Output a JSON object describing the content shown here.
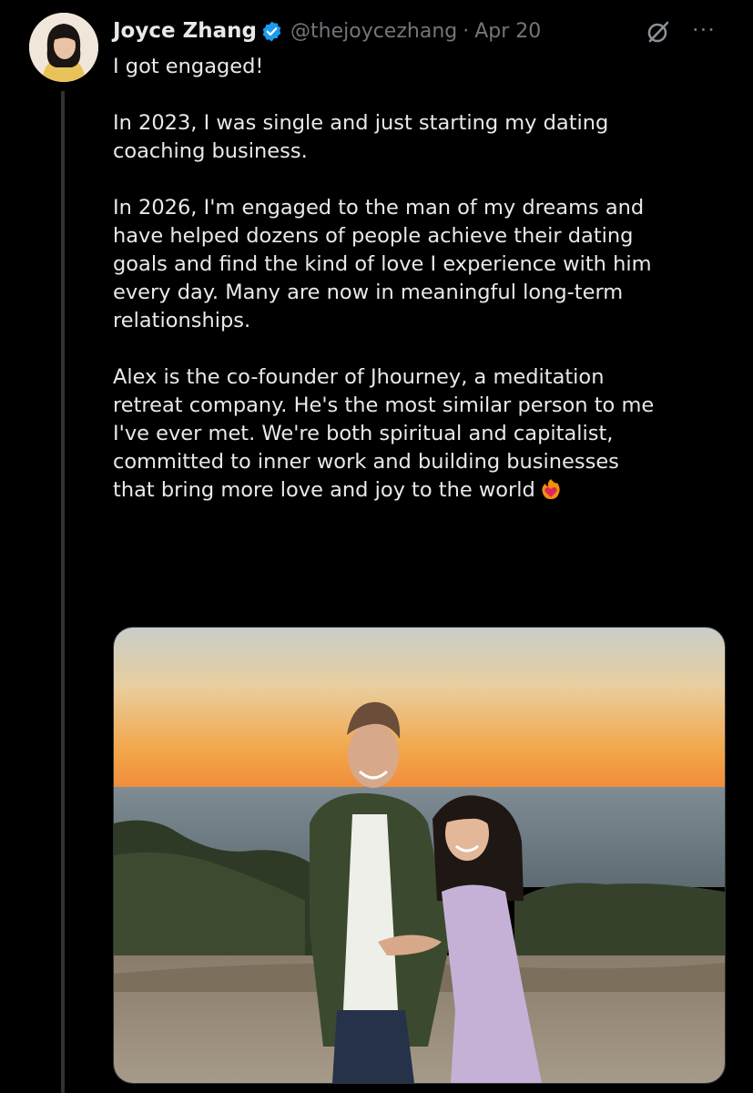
{
  "author": {
    "name": "Joyce Zhang",
    "handle": "@thejoycezhang",
    "separator": "·",
    "date": "Apr 20",
    "verified": true
  },
  "icons": {
    "avatar": "profile-photo",
    "verified": "verified-badge-icon",
    "grok": "grok-icon",
    "more": "more-icon",
    "emoji": "heart-on-fire"
  },
  "tweet": {
    "paragraphs": [
      "I got engaged!",
      "In 2023, I was single and just starting my dating\ncoaching business.",
      "In 2026, I'm engaged to the man of my dreams and\nhave helped dozens of people achieve their dating\ngoals and find the kind of love I experience with him\nevery day. Many are now in meaningful long-term\nrelationships.",
      "Alex is the co-founder of Jhourney, a meditation\nretreat company. He's the most similar person to me\nI've ever met. We're both spiritual and capitalist,\ncommitted to inner work and building businesses\nthat bring more love and joy to the world"
    ]
  },
  "more_label": "···",
  "media": {
    "kind": "photo"
  },
  "colors": {
    "background": "#000000",
    "text": "#e7e9ea",
    "muted": "#71767b",
    "verified": "#1d9bf0"
  }
}
